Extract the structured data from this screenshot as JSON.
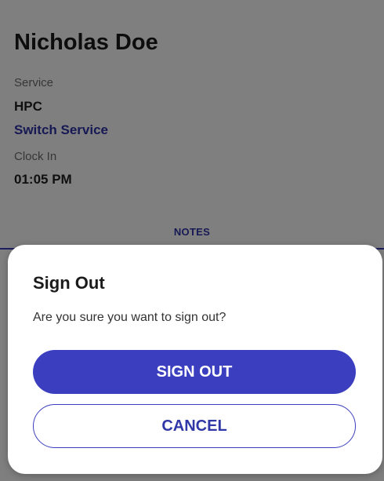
{
  "profile": {
    "name": "Nicholas Doe",
    "service_label": "Service",
    "service_value": "HPC",
    "switch_service_label": "Switch Service",
    "clock_in_label": "Clock In",
    "clock_in_value": "01:05 PM"
  },
  "tabs": {
    "notes_label": "NOTES"
  },
  "dialog": {
    "title": "Sign Out",
    "message": "Are you sure you want to sign out?",
    "confirm_label": "SIGN OUT",
    "cancel_label": "CANCEL"
  },
  "colors": {
    "accent": "#3b3fbf",
    "overlay": "rgba(0,0,0,0.5)"
  }
}
